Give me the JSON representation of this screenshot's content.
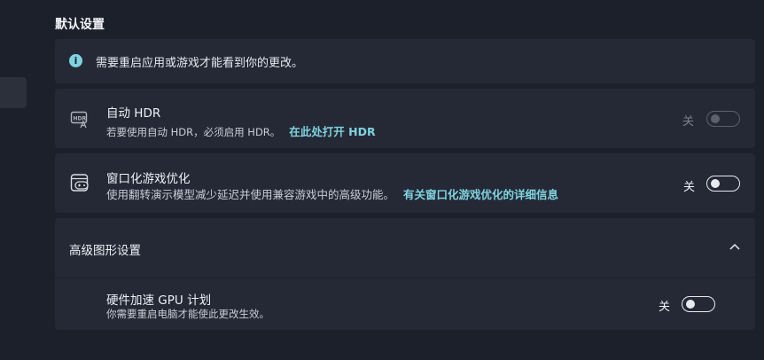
{
  "section_title": "默认设置",
  "info": {
    "icon": "info-icon",
    "text": "需要重启应用或游戏才能看到你的更改。",
    "accent": "#7fd3de"
  },
  "auto_hdr": {
    "icon": "hdr-icon",
    "title": "自动 HDR",
    "description": "若要使用自动 HDR，必须启用 HDR。",
    "link": "在此处打开 HDR",
    "toggle_label": "关",
    "toggle_state": "off",
    "enabled": false
  },
  "windowed_opt": {
    "icon": "gamepad-window-icon",
    "title": "窗口化游戏优化",
    "description": "使用翻转演示模型减少延迟并使用兼容游戏中的高级功能。",
    "link": "有关窗口化游戏优化的详细信息",
    "toggle_label": "关",
    "toggle_state": "off",
    "enabled": true
  },
  "advanced": {
    "header": "高级图形设置",
    "expanded": true,
    "gpu_scheduling": {
      "title": "硬件加速 GPU 计划",
      "description": "你需要重启电脑才能使此更改生效。",
      "toggle_label": "关",
      "toggle_state": "off"
    }
  },
  "colors": {
    "background": "#1c202b",
    "card": "#252936",
    "link": "#7fd3de"
  }
}
